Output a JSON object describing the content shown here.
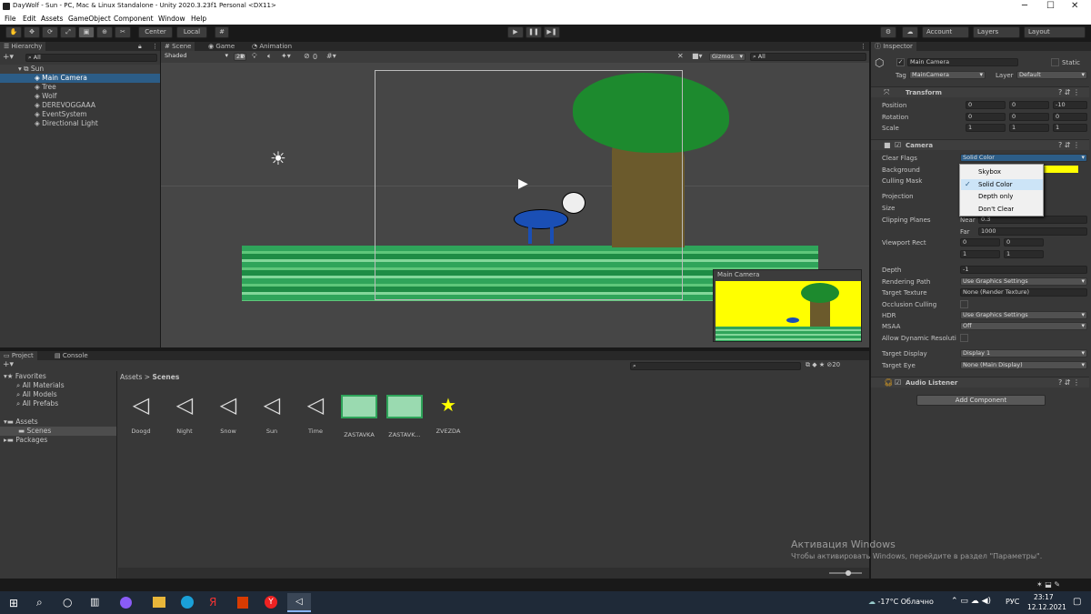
{
  "window": {
    "title": "DayWolf - Sun - PC, Mac & Linux Standalone - Unity 2020.3.23f1 Personal <DX11>",
    "min": "─",
    "max": "☐",
    "close": "✕"
  },
  "menu": [
    "File",
    "Edit",
    "Assets",
    "GameObject",
    "Component",
    "Window",
    "Help"
  ],
  "toolbar": {
    "center": "Center",
    "local": "Local",
    "account": "Account",
    "layers": "Layers",
    "layout": "Layout"
  },
  "hierarchy": {
    "tab": "Hierarchy",
    "search": "All",
    "scene": "Sun",
    "items": [
      "Main Camera",
      "Tree",
      "Wolf",
      "DEREVOGGAAA",
      "EventSystem",
      "Directional Light"
    ]
  },
  "scene": {
    "tabs": [
      "Scene",
      "Game",
      "Animation"
    ],
    "shading": "Shaded",
    "mode2d": "2D",
    "fx_count": "0",
    "gizmos": "Gizmos",
    "search": "All",
    "preview_title": "Main Camera"
  },
  "project": {
    "tabs": [
      "Project",
      "Console"
    ],
    "favorites": "Favorites",
    "fav_items": [
      "All Materials",
      "All Models",
      "All Prefabs"
    ],
    "assets": "Assets",
    "scenes": "Scenes",
    "packages": "Packages",
    "breadcrumb": [
      "Assets",
      "Scenes"
    ],
    "count": "20",
    "files": [
      "Doogd",
      "Night",
      "Snow",
      "Sun",
      "Time",
      "ZASTAVKA",
      "ZASTAVK...",
      "ZVEZDA"
    ]
  },
  "inspector": {
    "tab": "Inspector",
    "name": "Main Camera",
    "static": "Static",
    "tag_label": "Tag",
    "tag": "MainCamera",
    "layer_label": "Layer",
    "layer": "Default",
    "transform": {
      "title": "Transform",
      "rows": [
        {
          "label": "Position",
          "x": "0",
          "y": "0",
          "z": "-10"
        },
        {
          "label": "Rotation",
          "x": "0",
          "y": "0",
          "z": "0"
        },
        {
          "label": "Scale",
          "x": "1",
          "y": "1",
          "z": "1"
        }
      ]
    },
    "camera": {
      "title": "Camera",
      "clear_flags_label": "Clear Flags",
      "clear_flags": "Solid Color",
      "background_label": "Background",
      "background_color": "#ffff00",
      "culling_label": "Culling Mask",
      "projection_label": "Projection",
      "size_label": "Size",
      "clipping_label": "Clipping Planes",
      "near_label": "Near",
      "near": "0.3",
      "far_label": "Far",
      "far": "1000",
      "viewport_label": "Viewport Rect",
      "vx": "0",
      "vy": "0",
      "vw": "1",
      "vh": "1",
      "depth_label": "Depth",
      "depth": "-1",
      "rendering_label": "Rendering Path",
      "rendering": "Use Graphics Settings",
      "target_tex_label": "Target Texture",
      "target_tex": "None (Render Texture)",
      "occlusion_label": "Occlusion Culling",
      "hdr_label": "HDR",
      "hdr": "Use Graphics Settings",
      "msaa_label": "MSAA",
      "msaa": "Off",
      "dyn_label": "Allow Dynamic Resoluti",
      "display_label": "Target Display",
      "display": "Display 1",
      "eye_label": "Target Eye",
      "eye": "None (Main Display)"
    },
    "dropdown": [
      "Skybox",
      "Solid Color",
      "Depth only",
      "Don't Clear"
    ],
    "audio": "Audio Listener",
    "add_component": "Add Component"
  },
  "activation": {
    "title": "Активация Windows",
    "subtitle": "Чтобы активировать Windows, перейдите в раздел \"Параметры\"."
  },
  "taskbar": {
    "weather": "-17°C Облачно",
    "lang": "РУС",
    "time": "23:17",
    "date": "12.12.2021"
  },
  "colors": {
    "accent": "#2c5d87",
    "grass": "#2fa45a",
    "tree_top": "#1d8a2e",
    "trunk": "#6b5a2c",
    "wolf": "#1a4fb5",
    "preview_bg": "#ffff00"
  }
}
